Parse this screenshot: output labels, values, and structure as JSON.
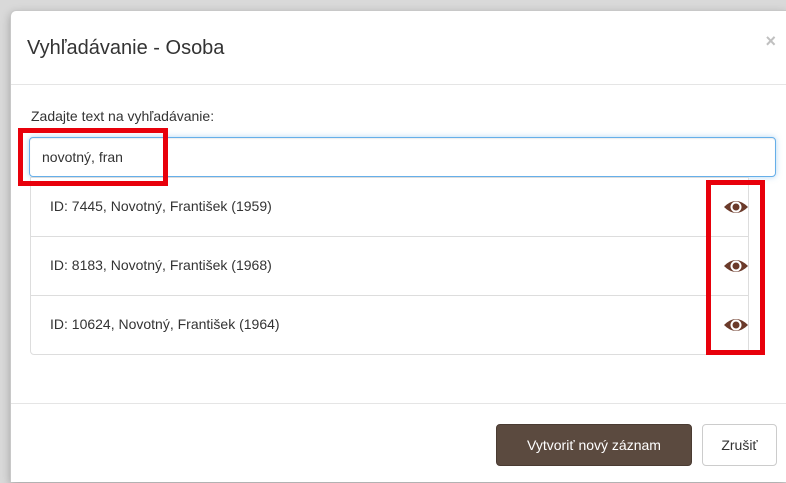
{
  "dialog": {
    "title": "Vyhľadávanie - Osoba",
    "close_symbol": "×"
  },
  "search": {
    "label": "Zadajte text na vyhľadávanie:",
    "value": "novotný, fran"
  },
  "results": [
    {
      "text": "ID: 7445, Novotný, František (1959)",
      "icon": "eye-icon"
    },
    {
      "text": "ID: 8183, Novotný, František (1968)",
      "icon": "eye-icon"
    },
    {
      "text": "ID: 10624, Novotný, František (1964)",
      "icon": "eye-icon"
    }
  ],
  "footer": {
    "create_label": "Vytvoriť nový záznam",
    "cancel_label": "Zrušiť"
  },
  "colors": {
    "primary_button": "#5b4a3f",
    "highlight": "#e8000b",
    "eye_icon": "#6b3a2a",
    "focus_border": "#66afe9"
  }
}
